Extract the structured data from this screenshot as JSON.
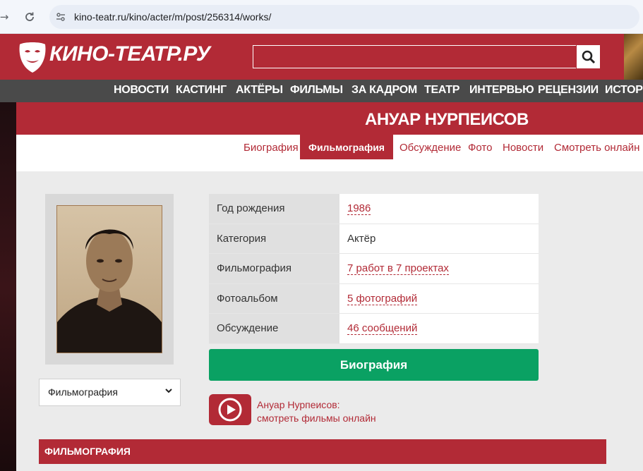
{
  "browser": {
    "url": "kino-teatr.ru/kino/acter/m/post/256314/works/"
  },
  "site": {
    "logo_text": "КИНО-ТЕАТР.РУ",
    "brand_color": "#b22a36"
  },
  "menu": {
    "items": [
      "НОВОСТИ",
      "КАСТИНГ",
      "АКТЁРЫ",
      "ФИЛЬМЫ",
      "ЗА КАДРОМ",
      "ТЕАТР",
      "ИНТЕРВЬЮ",
      "РЕЦЕНЗИИ",
      "ИСТОРИ"
    ]
  },
  "person": {
    "name": "АНУАР НУРПЕИСОВ"
  },
  "tabs": {
    "items": [
      "Биография",
      "Фильмография",
      "Обсуждение",
      "Фото",
      "Новости",
      "Смотреть онлайн"
    ],
    "active": "Фильмография"
  },
  "info": {
    "rows": [
      {
        "label": "Год рождения",
        "value": "1986"
      },
      {
        "label": "Категория",
        "value": "Актёр"
      },
      {
        "label": "Фильмография",
        "value": "7 работ в 7 проектах"
      },
      {
        "label": "Фотоальбом",
        "value": "5 фотографий"
      },
      {
        "label": "Обсуждение",
        "value": "46 сообщений"
      }
    ]
  },
  "select": {
    "selected": "Фильмография"
  },
  "bio_button": "Биография",
  "watch": {
    "line1": "Ануар Нурпеисов:",
    "line2": "смотреть фильмы онлайн"
  },
  "filmography_header": "ФИЛЬМОГРАФИЯ",
  "colors": {
    "accent": "#b22a36",
    "button_green": "#0aa163",
    "menu_bg": "#4a4a4a"
  }
}
